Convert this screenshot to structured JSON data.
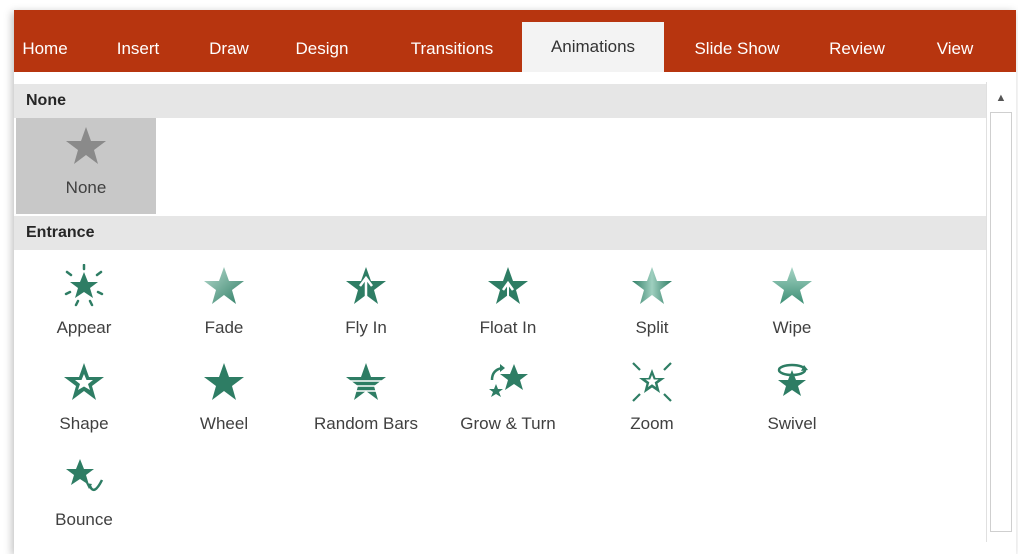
{
  "ribbon": {
    "tabs": [
      {
        "label": "Home",
        "active": false
      },
      {
        "label": "Insert",
        "active": false
      },
      {
        "label": "Draw",
        "active": false
      },
      {
        "label": "Design",
        "active": false
      },
      {
        "label": "Transitions",
        "active": false
      },
      {
        "label": "Animations",
        "active": true
      },
      {
        "label": "Slide Show",
        "active": false
      },
      {
        "label": "Review",
        "active": false
      },
      {
        "label": "View",
        "active": false
      }
    ],
    "accent": "#b7350f"
  },
  "gallery": {
    "none_section": {
      "title": "None",
      "items": [
        {
          "label": "None",
          "icon": "star-none-icon",
          "selected": true
        }
      ]
    },
    "entrance_section": {
      "title": "Entrance",
      "items": [
        {
          "label": "Appear",
          "icon": "appear-icon"
        },
        {
          "label": "Fade",
          "icon": "fade-icon"
        },
        {
          "label": "Fly In",
          "icon": "fly-in-icon"
        },
        {
          "label": "Float In",
          "icon": "float-in-icon"
        },
        {
          "label": "Split",
          "icon": "split-icon"
        },
        {
          "label": "Wipe",
          "icon": "wipe-icon"
        },
        {
          "label": "Shape",
          "icon": "shape-icon"
        },
        {
          "label": "Wheel",
          "icon": "wheel-icon"
        },
        {
          "label": "Random Bars",
          "icon": "random-bars-icon"
        },
        {
          "label": "Grow & Turn",
          "icon": "grow-turn-icon"
        },
        {
          "label": "Zoom",
          "icon": "zoom-icon"
        },
        {
          "label": "Swivel",
          "icon": "swivel-icon"
        },
        {
          "label": "Bounce",
          "icon": "bounce-icon"
        }
      ]
    },
    "icon_color": "#2e7d64",
    "none_icon_color": "#8a8a8a"
  },
  "scrollbar": {
    "up_arrow": "▲"
  }
}
